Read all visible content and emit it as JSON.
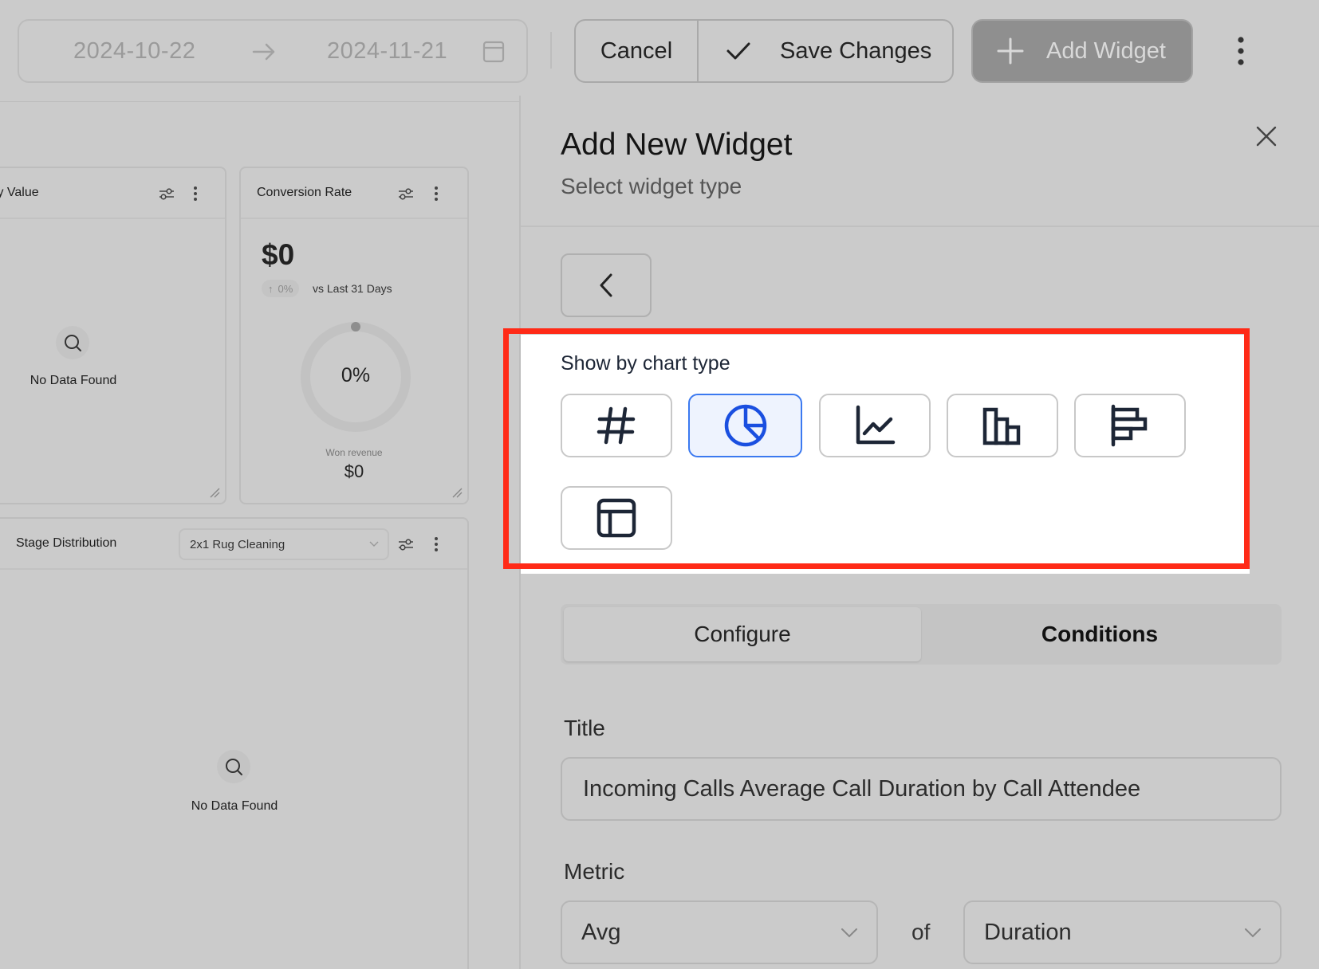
{
  "toolbar": {
    "date_start": "2024-10-22",
    "date_end": "2024-11-21",
    "cancel_label": "Cancel",
    "save_label": "Save Changes",
    "add_widget_label": "Add Widget"
  },
  "dashboard": {
    "card1": {
      "title_fragment": "ty Value",
      "empty_text": "No Data Found"
    },
    "card2": {
      "title": "Conversion Rate",
      "value": "$0",
      "delta": "0%",
      "comparison": "vs Last 31 Days",
      "donut_value": "0%",
      "donut_sub_label": "Won revenue",
      "donut_sub_value": "$0"
    },
    "card3": {
      "title": "Stage Distribution",
      "pipeline_select": "2x1 Rug Cleaning",
      "empty_text": "No Data Found"
    }
  },
  "drawer": {
    "title": "Add New Widget",
    "subtitle": "Select widget type",
    "chart_type_label": "Show by chart type",
    "chart_types": [
      {
        "name": "number",
        "icon": "hash-icon",
        "selected": false
      },
      {
        "name": "pie",
        "icon": "pie-chart-icon",
        "selected": true
      },
      {
        "name": "line",
        "icon": "line-chart-icon",
        "selected": false
      },
      {
        "name": "bar",
        "icon": "bar-chart-icon",
        "selected": false
      },
      {
        "name": "horizontal-bar",
        "icon": "horizontal-bar-chart-icon",
        "selected": false
      },
      {
        "name": "table",
        "icon": "table-icon",
        "selected": false
      }
    ],
    "tabs": [
      {
        "label": "Configure",
        "active": true
      },
      {
        "label": "Conditions",
        "active": false
      }
    ],
    "title_field_label": "Title",
    "title_field_value": "Incoming Calls Average Call Duration by Call Attendee",
    "metric_label": "Metric",
    "metric_aggregation": "Avg",
    "metric_of": "of",
    "metric_field": "Duration"
  },
  "colors": {
    "highlight": "#ff2a17",
    "selected_accent": "#1a4fe0",
    "icon_stroke": "#1d2636"
  }
}
